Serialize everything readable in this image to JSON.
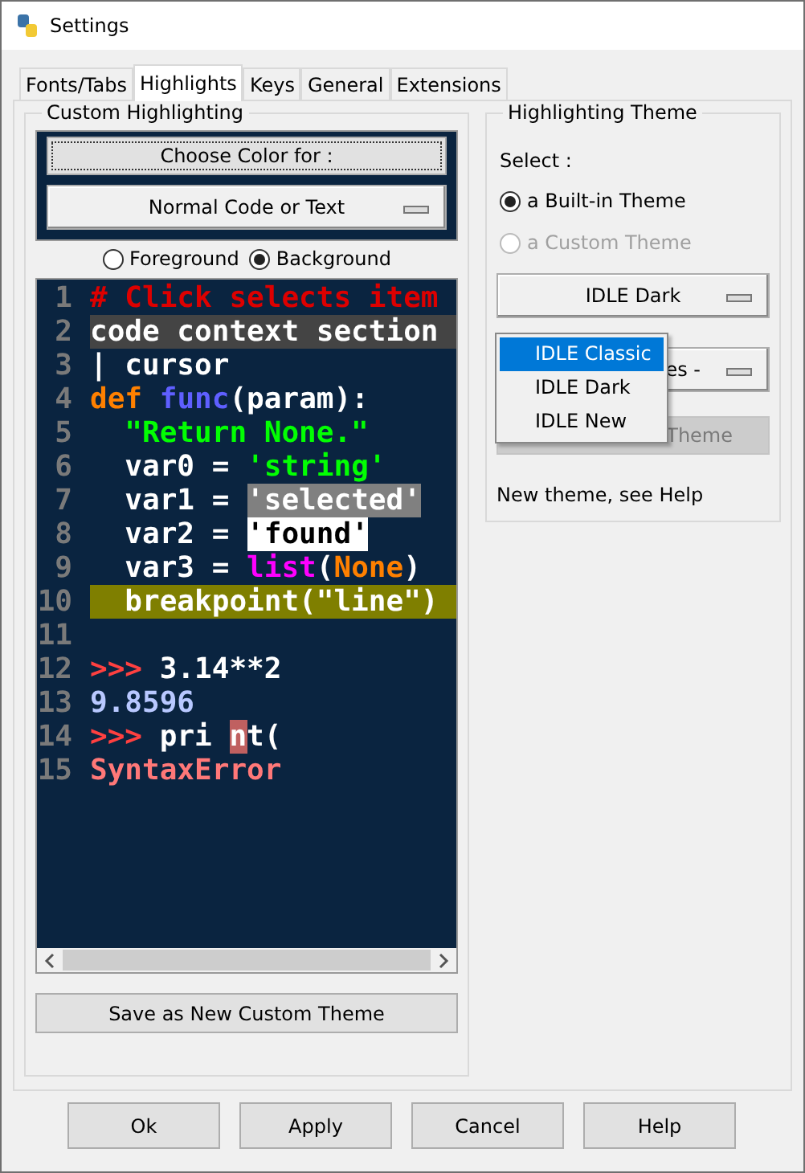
{
  "window": {
    "title": "Settings"
  },
  "tabs": [
    {
      "label": "Fonts/Tabs",
      "selected": false
    },
    {
      "label": "Highlights",
      "selected": true
    },
    {
      "label": "Keys",
      "selected": false
    },
    {
      "label": "General",
      "selected": false
    },
    {
      "label": "Extensions",
      "selected": false
    }
  ],
  "custom_highlighting": {
    "title": "Custom Highlighting",
    "choose_color_button": "Choose Color for :",
    "element_menu": "Normal Code or Text",
    "target": [
      {
        "label": "Foreground",
        "selected": false
      },
      {
        "label": "Background",
        "selected": true
      }
    ],
    "code_lines": [
      {
        "number": "1",
        "kind": "normal",
        "segments": [
          {
            "kind": "comment",
            "text": "# Click selects item"
          }
        ]
      },
      {
        "number": "2",
        "kind": "context",
        "segments": [
          {
            "kind": "normal",
            "text": "code context section"
          }
        ]
      },
      {
        "number": "3",
        "kind": "normal",
        "segments": [
          {
            "kind": "normal",
            "text": "| cursor"
          }
        ]
      },
      {
        "number": "4",
        "kind": "normal",
        "segments": [
          {
            "kind": "keyword",
            "text": "def "
          },
          {
            "kind": "definition",
            "text": "func"
          },
          {
            "kind": "normal",
            "text": "(param):"
          }
        ]
      },
      {
        "number": "5",
        "kind": "normal",
        "segments": [
          {
            "kind": "string",
            "text": "  \"Return None.\""
          }
        ]
      },
      {
        "number": "6",
        "kind": "normal",
        "segments": [
          {
            "kind": "normal",
            "text": "  var0 = "
          },
          {
            "kind": "string",
            "text": "'string'"
          }
        ]
      },
      {
        "number": "7",
        "kind": "normal",
        "segments": [
          {
            "kind": "normal",
            "text": "  var1 = "
          },
          {
            "kind": "selected",
            "text": "'selected'"
          }
        ]
      },
      {
        "number": "8",
        "kind": "normal",
        "segments": [
          {
            "kind": "normal",
            "text": "  var2 = "
          },
          {
            "kind": "found",
            "text": "'found'"
          }
        ]
      },
      {
        "number": "9",
        "kind": "normal",
        "segments": [
          {
            "kind": "normal",
            "text": "  var3 = "
          },
          {
            "kind": "builtin",
            "text": "list"
          },
          {
            "kind": "normal",
            "text": "("
          },
          {
            "kind": "keyword",
            "text": "None"
          },
          {
            "kind": "normal",
            "text": ")"
          }
        ]
      },
      {
        "number": "10",
        "kind": "breakpoint",
        "segments": [
          {
            "kind": "normal",
            "text": "  breakpoint(\"line\")"
          }
        ]
      },
      {
        "number": "11",
        "kind": "normal"
      },
      {
        "number": "12",
        "kind": "normal",
        "segments": [
          {
            "kind": "prompt",
            "text": ">>>"
          },
          {
            "kind": "normal",
            "text": " 3.14**2"
          }
        ]
      },
      {
        "number": "13",
        "kind": "normal",
        "segments": [
          {
            "kind": "stdout",
            "text": "9.8596"
          }
        ]
      },
      {
        "number": "14",
        "kind": "normal",
        "segments": [
          {
            "kind": "prompt",
            "text": ">>>"
          },
          {
            "kind": "normal",
            "text": " pri "
          },
          {
            "kind": "error",
            "text": "n"
          },
          {
            "kind": "normal",
            "text": "t("
          }
        ]
      },
      {
        "number": "15",
        "kind": "normal",
        "segments": [
          {
            "kind": "stderr",
            "text": "SyntaxError"
          }
        ]
      }
    ],
    "save_button": "Save as New Custom Theme"
  },
  "highlighting_theme": {
    "title": "Highlighting Theme",
    "select_label": "Select :",
    "theme_type": [
      {
        "label": "a Built-in Theme",
        "selected": true,
        "disabled": false
      },
      {
        "label": "a Custom Theme",
        "selected": false,
        "disabled": true
      }
    ],
    "builtin_menu": "IDLE Dark",
    "custom_menu": "es -",
    "delete_button": {
      "label": "Theme",
      "disabled": true
    },
    "help_note": "New theme, see Help",
    "dropdown": {
      "items": [
        {
          "label": "IDLE Classic",
          "selected": true
        },
        {
          "label": "IDLE Dark",
          "selected": false
        },
        {
          "label": "IDLE New",
          "selected": false
        }
      ]
    }
  },
  "buttons": [
    "Ok",
    "Apply",
    "Cancel",
    "Help"
  ]
}
